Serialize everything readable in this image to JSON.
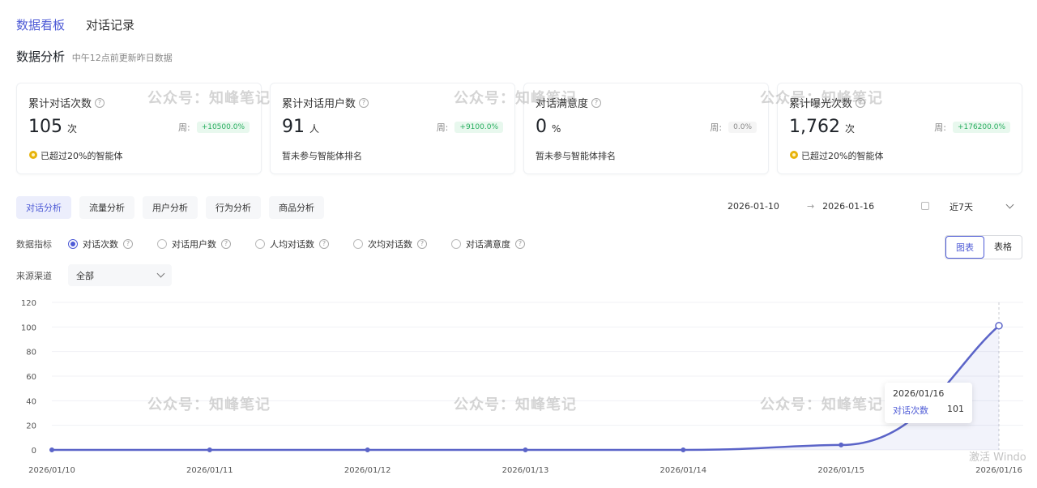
{
  "tabs": [
    {
      "label": "数据看板",
      "active": true
    },
    {
      "label": "对话记录",
      "active": false
    }
  ],
  "section": {
    "title": "数据分析",
    "subtitle": "中午12点前更新昨日数据"
  },
  "cards": [
    {
      "title": "累计对话次数",
      "value": "105",
      "unit": "次",
      "week_label": "周:",
      "week_change": "+10500.0%",
      "footer": "已超过20%的智能体",
      "medal": true
    },
    {
      "title": "累计对话用户数",
      "value": "91",
      "unit": "人",
      "week_label": "周:",
      "week_change": "+9100.0%",
      "footer": "暂未参与智能体排名",
      "medal": false
    },
    {
      "title": "对话满意度",
      "value": "0",
      "unit": "%",
      "week_label": "周:",
      "week_change": "0.0%",
      "footer": "暂未参与智能体排名",
      "medal": false
    },
    {
      "title": "累计曝光次数",
      "value": "1,762",
      "unit": "次",
      "week_label": "周:",
      "week_change": "+176200.0%",
      "footer": "已超过20%的智能体",
      "medal": true
    }
  ],
  "subtabs": [
    {
      "label": "对话分析",
      "active": true
    },
    {
      "label": "流量分析",
      "active": false
    },
    {
      "label": "用户分析",
      "active": false
    },
    {
      "label": "行为分析",
      "active": false
    },
    {
      "label": "商品分析",
      "active": false
    }
  ],
  "date_range": {
    "start": "2026-01-10",
    "end": "2026-01-16",
    "arrow": "→"
  },
  "period_select": "近7天",
  "metrics": {
    "label": "数据指标",
    "options": [
      {
        "label": "对话次数",
        "selected": true
      },
      {
        "label": "对话用户数",
        "selected": false
      },
      {
        "label": "人均对话数",
        "selected": false
      },
      {
        "label": "次均对话数",
        "selected": false
      },
      {
        "label": "对话满意度",
        "selected": false
      }
    ]
  },
  "view_toggle": {
    "chart": "图表",
    "table": "表格"
  },
  "source": {
    "label": "来源渠道",
    "value": "全部"
  },
  "chart_data": {
    "type": "area",
    "x": [
      "2026/01/10",
      "2026/01/11",
      "2026/01/12",
      "2026/01/13",
      "2026/01/14",
      "2026/01/15",
      "2026/01/16"
    ],
    "series": [
      {
        "name": "对话次数",
        "values": [
          0,
          0,
          0,
          0,
          0,
          4,
          101
        ]
      }
    ],
    "yticks": [
      0,
      20,
      40,
      60,
      80,
      100,
      120
    ],
    "ylim": [
      0,
      120
    ],
    "grid": true,
    "color": "#5b64c8"
  },
  "tooltip": {
    "date": "2026/01/16",
    "series": "对话次数",
    "value": "101"
  },
  "watermark": "公众号：知峰笔记",
  "os_overlay": "激活 Windo"
}
